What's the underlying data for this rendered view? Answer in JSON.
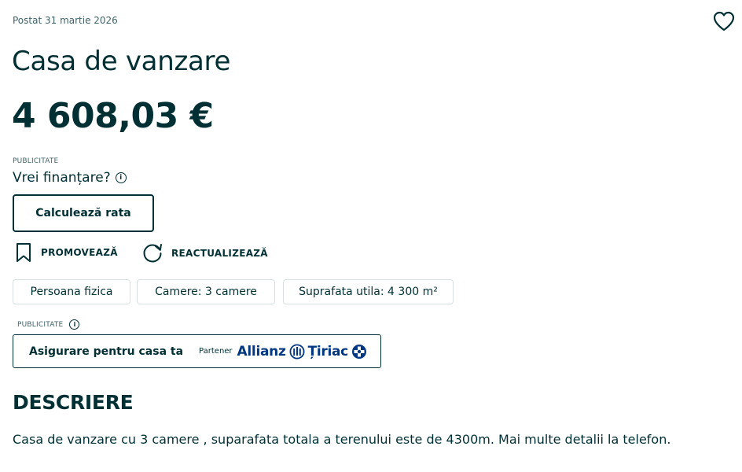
{
  "listing": {
    "posted": "Postat 31 martie 2026",
    "title": "Casa de vanzare",
    "price": "4 608,03 €"
  },
  "favorite": {
    "icon": "heart-outline-icon"
  },
  "finance_ad": {
    "label": "PUBLICITATE",
    "question": "Vrei finanțare?",
    "info_icon": "info-icon",
    "button": "Calculează rata"
  },
  "actions": [
    {
      "label": "PROMOVEAZĂ",
      "icon": "bookmark-icon"
    },
    {
      "label": "REACTUALIZEAZĂ",
      "icon": "refresh-icon"
    }
  ],
  "tags": [
    "Persoana fizica",
    "Camere: 3 camere",
    "Suprafata utila: 4 300 m²"
  ],
  "insurance_ad": {
    "label": "PUBLICITATE",
    "title": "Asigurare pentru casa ta",
    "partner_label": "Partener",
    "logo_text_1": "Allianz",
    "logo_text_2": "Țiriac"
  },
  "description": {
    "heading": "DESCRIERE",
    "text": "Casa de vanzare cu 3 camere , suparafata totala a terenului este de 4300m. Mai multe detalii la telefon."
  },
  "colors": {
    "text": "#002f34",
    "muted": "#406367",
    "border": "#d8dfe0",
    "partner_blue": "#003781"
  }
}
